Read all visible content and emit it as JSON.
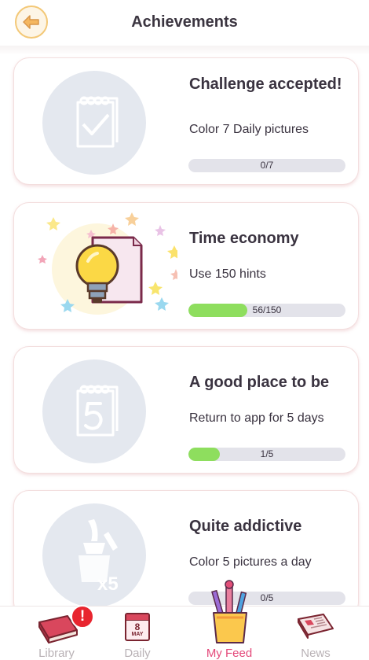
{
  "header": {
    "title": "Achievements"
  },
  "achievements": [
    {
      "title": "Challenge accepted!",
      "description": "Color 7 Daily pictures",
      "progress_text": "0/7",
      "progress_fraction": 0.0,
      "icon": "calendar-check-icon",
      "unlocked": false
    },
    {
      "title": "Time economy",
      "description": "Use 150 hints",
      "progress_text": "56/150",
      "progress_fraction": 0.373,
      "icon": "lightbulb-icon",
      "unlocked": true
    },
    {
      "title": "A good place to be",
      "description": "Return to app for 5 days",
      "progress_text": "1/5",
      "progress_fraction": 0.2,
      "icon": "calendar-five-icon",
      "unlocked": false
    },
    {
      "title": "Quite addictive",
      "description": "Color 5 pictures a day",
      "progress_text": "0/5",
      "progress_fraction": 0.0,
      "icon": "paintbrush-jar-x5-icon",
      "unlocked": false
    }
  ],
  "bottom_nav": {
    "items": [
      {
        "label": "Library",
        "icon": "book-icon",
        "badge": "!"
      },
      {
        "label": "Daily",
        "icon": "calendar-icon",
        "calendar_day": "8",
        "calendar_month": "MAY"
      },
      {
        "label": "My Feed",
        "icon": "pencil-cup-icon",
        "active": true
      },
      {
        "label": "News",
        "icon": "newspaper-icon"
      }
    ]
  },
  "colors": {
    "accent_pink": "#e4497a",
    "progress_green": "#8ede5e",
    "back_button_border": "#f3c877"
  }
}
